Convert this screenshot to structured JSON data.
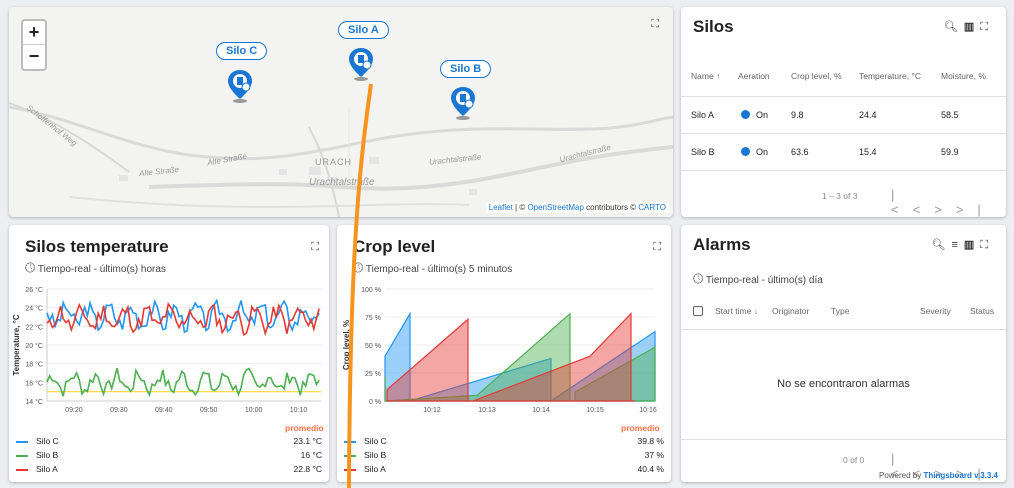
{
  "map": {
    "silos": [
      {
        "label": "Silo A"
      },
      {
        "label": "Silo B"
      },
      {
        "label": "Silo C"
      }
    ],
    "streets": [
      "Alte Straße",
      "Alte Straße",
      "URACH",
      "Urachtalstraße",
      "Urachtalstraße",
      "Urachtalstraße",
      "Schoffenhof Weg"
    ],
    "attribution": {
      "leaflet": "Leaflet",
      "sep": " | © ",
      "osm": "OpenStreetMap",
      "mid": " contributors © ",
      "carto": "CARTO"
    },
    "zoom_in": "+",
    "zoom_out": "−"
  },
  "silos_table": {
    "title": "Silos",
    "columns": [
      "Name ↑",
      "Aeration",
      "Crop level, %",
      "Temperature, °C",
      "Moisture, %"
    ],
    "rows": [
      {
        "name": "Silo A",
        "aeration": "On",
        "crop": "9.8",
        "temp": "24.4",
        "moisture": "58.5"
      },
      {
        "name": "Silo B",
        "aeration": "On",
        "crop": "63.6",
        "temp": "15.4",
        "moisture": "59.9"
      }
    ],
    "pagination": "1 – 3 of 3",
    "accent": "#1976d2"
  },
  "temp_chart": {
    "title": "Silos temperature",
    "subtitle": "Tiempo-real - último(s) horas",
    "legend_header": "promedio",
    "legend": [
      {
        "name": "Silo C",
        "value": "23.1 °C",
        "color": "#2196f3"
      },
      {
        "name": "Silo B",
        "value": "16 °C",
        "color": "#4caf50"
      },
      {
        "name": "Silo A",
        "value": "22.8 °C",
        "color": "#e53935"
      }
    ]
  },
  "crop_chart": {
    "title": "Crop level",
    "subtitle": "Tiempo-real - último(s) 5 minutos",
    "legend_header": "promedio",
    "legend": [
      {
        "name": "Silo C",
        "value": "39.8 %",
        "color": "#2196f3"
      },
      {
        "name": "Silo B",
        "value": "37 %",
        "color": "#4caf50"
      },
      {
        "name": "Silo A",
        "value": "40.4 %",
        "color": "#e53935"
      }
    ]
  },
  "alarms": {
    "title": "Alarms",
    "subtitle": "Tiempo-real - último(s) día",
    "columns": [
      "Start time ↓",
      "Originator",
      "Type",
      "Severity",
      "Status"
    ],
    "empty": "No se encontraron alarmas",
    "pagination": "0 of 0",
    "powered_prefix": "Powered by ",
    "powered_link": "Thingsboard v.3.3.4"
  },
  "chart_data": [
    {
      "type": "line",
      "title": "Silos temperature",
      "xlabel": "",
      "ylabel": "Temperature, °C",
      "ylim": [
        14,
        26
      ],
      "y_ticks": [
        "26 °C",
        "24 °C",
        "22 °C",
        "20 °C",
        "18 °C",
        "16 °C",
        "14 °C"
      ],
      "x_ticks": [
        "09:20",
        "09:30",
        "09:40",
        "09:50",
        "10:00",
        "10:10"
      ],
      "x_tick_minutes": [
        20,
        30,
        40,
        50,
        60,
        70
      ],
      "xlim_minutes": [
        14,
        75
      ],
      "grid": true,
      "legend_placement": "bottom",
      "series": [
        {
          "name": "Silo C",
          "approx_values_minutes": [
            14,
            75
          ],
          "mean": 23.1,
          "range": [
            22,
            24.8
          ]
        },
        {
          "name": "Silo A",
          "mean": 22.8,
          "range": [
            21.5,
            24.3
          ]
        },
        {
          "name": "Silo B",
          "mean": 16,
          "range": [
            15,
            17.6
          ]
        },
        {
          "name": "",
          "constant": 15,
          "color": "#fdd835"
        }
      ]
    },
    {
      "type": "area",
      "title": "Crop level",
      "xlabel": "",
      "ylabel": "Crop level, %",
      "ylim": [
        0,
        100
      ],
      "y_ticks": [
        "100 %",
        "75 %",
        "50 %",
        "25 %",
        "0 %"
      ],
      "x_ticks": [
        "10:12",
        "10:13",
        "10:14",
        "10:15",
        "10:16"
      ],
      "grid": true,
      "legend_placement": "bottom",
      "series": [
        {
          "name": "Silo C",
          "mean": 39.8
        },
        {
          "name": "Silo B",
          "mean": 37
        },
        {
          "name": "Silo A",
          "mean": 40.4
        }
      ]
    }
  ]
}
